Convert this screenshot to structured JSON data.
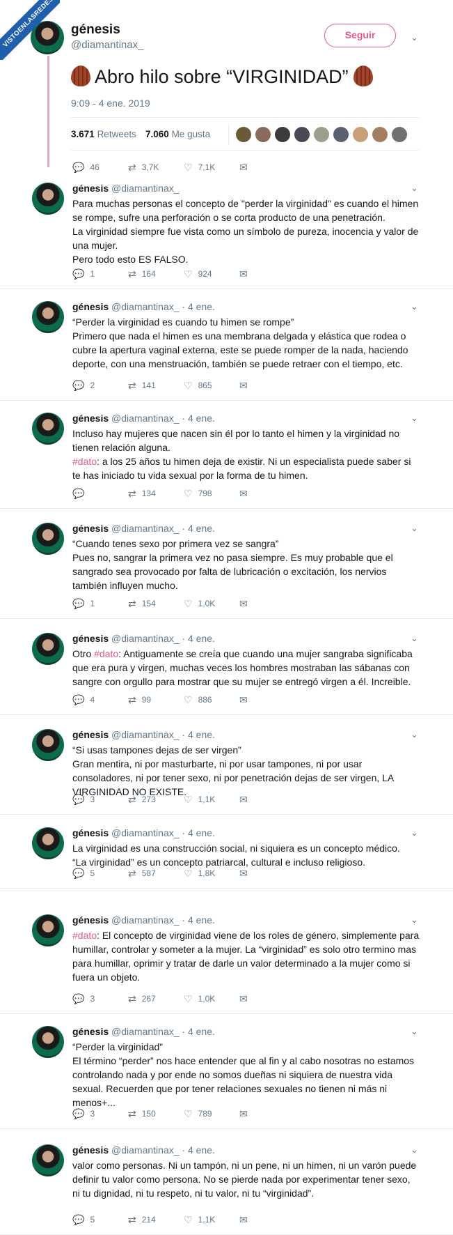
{
  "watermark": "VISTOENLASREDES",
  "main_tweet": {
    "name": "génesis",
    "handle": "@diamantinax_",
    "follow_label": "Seguir",
    "text": "Abro hilo sobre “VIRGINIDAD”",
    "emoji_icon": "chestnut-icon",
    "timestamp": "9:09 - 4 ene. 2019",
    "retweets": "3.671",
    "retweets_label": "Retweets",
    "likes": "7.060",
    "likes_label": "Me gusta",
    "reply_count": "46",
    "rt_count": "3,7K",
    "like_count": "7,1K"
  },
  "colors": {
    "accent": "#e05a8a",
    "thread_line": "#e1a6cc",
    "muted": "#657786",
    "watermark": "#1f5fae"
  },
  "tweets": [
    {
      "name": "génesis",
      "meta": "@diamantinax_",
      "lines": [
        "Para muchas personas el concepto de \"perder la virginidad\" es cuando el himen se rompe, sufre una perforación o se corta producto de una penetración.",
        "La virginidad siempre fue vista como un símbolo de pureza, inocencia y valor de una mujer.",
        "Pero todo esto ES FALSO."
      ],
      "replies": "1",
      "rts": "164",
      "likes": "924"
    },
    {
      "name": "génesis",
      "meta": "@diamantinax_ · 4 ene.",
      "lines": [
        "“Perder la virginidad es cuando tu himen se rompe”",
        "Primero que nada el himen es una membrana delgada y elástica que rodea o cubre la apertura vaginal externa, este se puede romper de la nada, haciendo deporte, con una menstruación, también se puede retraer con el tiempo, etc."
      ],
      "replies": "2",
      "rts": "141",
      "likes": "865"
    },
    {
      "name": "génesis",
      "meta": "@diamantinax_ · 4 ene.",
      "lines": [
        "Incluso hay mujeres que nacen sin él por lo tanto el himen y la virginidad no tienen relación alguna."
      ],
      "hash_line": {
        "tag": "#dato",
        "rest": ": a los 25 años tu himen deja de existir. Ni un especialista puede saber si te has iniciado tu vida sexual por la forma de tu himen."
      },
      "replies": "",
      "rts": "134",
      "likes": "798"
    },
    {
      "name": "génesis",
      "meta": "@diamantinax_ · 4 ene.",
      "lines": [
        "“Cuando tenes sexo por primera vez se sangra”",
        "Pues no, sangrar la primera vez no pasa siempre. Es muy probable que el sangrado sea provocado por falta de lubricación o excitación, los nervios también influyen mucho."
      ],
      "replies": "1",
      "rts": "154",
      "likes": "1,0K"
    },
    {
      "name": "génesis",
      "meta": "@diamantinax_ · 4 ene.",
      "prefix": "Otro ",
      "hash_line": {
        "tag": "#dato",
        "rest": ": Antiguamente se creía que cuando una mujer sangraba significaba que era pura y virgen, muchas veces los hombres mostraban las sábanas con sangre con orgullo para mostrar que su mujer se entregó virgen a él. Increible."
      },
      "replies": "4",
      "rts": "99",
      "likes": "886"
    },
    {
      "name": "génesis",
      "meta": "@diamantinax_ · 4 ene.",
      "lines": [
        "“Si usas tampones dejas de ser virgen”",
        "Gran mentira, ni por masturbarte, ni por usar tampones, ni por usar consoladores, ni por tener sexo, ni por penetración dejas de ser virgen, LA VIRGINIDAD NO EXISTE."
      ],
      "replies": "3",
      "rts": "273",
      "likes": "1,1K"
    },
    {
      "name": "génesis",
      "meta": "@diamantinax_ · 4 ene.",
      "lines": [
        "La virginidad es una construcción social, ni siquiera es un concepto médico.",
        "“La virginidad” es un concepto patriarcal, cultural e incluso religioso."
      ],
      "replies": "5",
      "rts": "587",
      "likes": "1,8K"
    },
    {
      "name": "génesis",
      "meta": "@diamantinax_ · 4 ene.",
      "hash_line": {
        "tag": "#dato",
        "rest": ": El concepto de virginidad viene de los roles de género, simplemente para humillar, controlar y someter a la mujer. La “virginidad” es solo otro termino mas para humillar, oprimir y tratar de darle un valor determinado a la mujer como si fuera un objeto."
      },
      "replies": "3",
      "rts": "267",
      "likes": "1,0K"
    },
    {
      "name": "génesis",
      "meta": "@diamantinax_ · 4 ene.",
      "lines": [
        "“Perder la virginidad”",
        "El término “perder” nos hace entender que al fin y al cabo nosotras no estamos controlando nada y por ende no somos dueñas ni siquiera de nuestra vida sexual. Recuerden que por tener relaciones sexuales no tienen ni más ni menos+..."
      ],
      "replies": "3",
      "rts": "150",
      "likes": "789"
    },
    {
      "name": "génesis",
      "meta": "@diamantinax_ · 4 ene.",
      "lines": [
        "valor como personas. Ni un tampón, ni un pene, ni un himen, ni un varón puede definir tu valor como persona. No se pierde nada por experimentar tener sexo, ni tu dignidad, ni tu respeto, ni tu valor, ni tu “virginidad”."
      ],
      "replies": "5",
      "rts": "214",
      "likes": "1,1K"
    }
  ]
}
